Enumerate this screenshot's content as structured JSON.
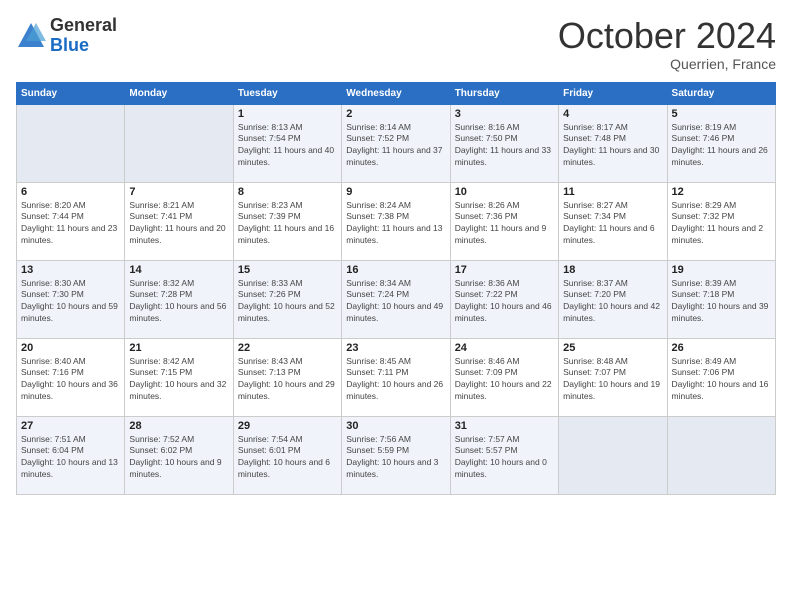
{
  "logo": {
    "general": "General",
    "blue": "Blue"
  },
  "header": {
    "month": "October 2024",
    "location": "Querrien, France"
  },
  "weekdays": [
    "Sunday",
    "Monday",
    "Tuesday",
    "Wednesday",
    "Thursday",
    "Friday",
    "Saturday"
  ],
  "weeks": [
    [
      {
        "day": "",
        "sunrise": "",
        "sunset": "",
        "daylight": ""
      },
      {
        "day": "",
        "sunrise": "",
        "sunset": "",
        "daylight": ""
      },
      {
        "day": "1",
        "sunrise": "Sunrise: 8:13 AM",
        "sunset": "Sunset: 7:54 PM",
        "daylight": "Daylight: 11 hours and 40 minutes."
      },
      {
        "day": "2",
        "sunrise": "Sunrise: 8:14 AM",
        "sunset": "Sunset: 7:52 PM",
        "daylight": "Daylight: 11 hours and 37 minutes."
      },
      {
        "day": "3",
        "sunrise": "Sunrise: 8:16 AM",
        "sunset": "Sunset: 7:50 PM",
        "daylight": "Daylight: 11 hours and 33 minutes."
      },
      {
        "day": "4",
        "sunrise": "Sunrise: 8:17 AM",
        "sunset": "Sunset: 7:48 PM",
        "daylight": "Daylight: 11 hours and 30 minutes."
      },
      {
        "day": "5",
        "sunrise": "Sunrise: 8:19 AM",
        "sunset": "Sunset: 7:46 PM",
        "daylight": "Daylight: 11 hours and 26 minutes."
      }
    ],
    [
      {
        "day": "6",
        "sunrise": "Sunrise: 8:20 AM",
        "sunset": "Sunset: 7:44 PM",
        "daylight": "Daylight: 11 hours and 23 minutes."
      },
      {
        "day": "7",
        "sunrise": "Sunrise: 8:21 AM",
        "sunset": "Sunset: 7:41 PM",
        "daylight": "Daylight: 11 hours and 20 minutes."
      },
      {
        "day": "8",
        "sunrise": "Sunrise: 8:23 AM",
        "sunset": "Sunset: 7:39 PM",
        "daylight": "Daylight: 11 hours and 16 minutes."
      },
      {
        "day": "9",
        "sunrise": "Sunrise: 8:24 AM",
        "sunset": "Sunset: 7:38 PM",
        "daylight": "Daylight: 11 hours and 13 minutes."
      },
      {
        "day": "10",
        "sunrise": "Sunrise: 8:26 AM",
        "sunset": "Sunset: 7:36 PM",
        "daylight": "Daylight: 11 hours and 9 minutes."
      },
      {
        "day": "11",
        "sunrise": "Sunrise: 8:27 AM",
        "sunset": "Sunset: 7:34 PM",
        "daylight": "Daylight: 11 hours and 6 minutes."
      },
      {
        "day": "12",
        "sunrise": "Sunrise: 8:29 AM",
        "sunset": "Sunset: 7:32 PM",
        "daylight": "Daylight: 11 hours and 2 minutes."
      }
    ],
    [
      {
        "day": "13",
        "sunrise": "Sunrise: 8:30 AM",
        "sunset": "Sunset: 7:30 PM",
        "daylight": "Daylight: 10 hours and 59 minutes."
      },
      {
        "day": "14",
        "sunrise": "Sunrise: 8:32 AM",
        "sunset": "Sunset: 7:28 PM",
        "daylight": "Daylight: 10 hours and 56 minutes."
      },
      {
        "day": "15",
        "sunrise": "Sunrise: 8:33 AM",
        "sunset": "Sunset: 7:26 PM",
        "daylight": "Daylight: 10 hours and 52 minutes."
      },
      {
        "day": "16",
        "sunrise": "Sunrise: 8:34 AM",
        "sunset": "Sunset: 7:24 PM",
        "daylight": "Daylight: 10 hours and 49 minutes."
      },
      {
        "day": "17",
        "sunrise": "Sunrise: 8:36 AM",
        "sunset": "Sunset: 7:22 PM",
        "daylight": "Daylight: 10 hours and 46 minutes."
      },
      {
        "day": "18",
        "sunrise": "Sunrise: 8:37 AM",
        "sunset": "Sunset: 7:20 PM",
        "daylight": "Daylight: 10 hours and 42 minutes."
      },
      {
        "day": "19",
        "sunrise": "Sunrise: 8:39 AM",
        "sunset": "Sunset: 7:18 PM",
        "daylight": "Daylight: 10 hours and 39 minutes."
      }
    ],
    [
      {
        "day": "20",
        "sunrise": "Sunrise: 8:40 AM",
        "sunset": "Sunset: 7:16 PM",
        "daylight": "Daylight: 10 hours and 36 minutes."
      },
      {
        "day": "21",
        "sunrise": "Sunrise: 8:42 AM",
        "sunset": "Sunset: 7:15 PM",
        "daylight": "Daylight: 10 hours and 32 minutes."
      },
      {
        "day": "22",
        "sunrise": "Sunrise: 8:43 AM",
        "sunset": "Sunset: 7:13 PM",
        "daylight": "Daylight: 10 hours and 29 minutes."
      },
      {
        "day": "23",
        "sunrise": "Sunrise: 8:45 AM",
        "sunset": "Sunset: 7:11 PM",
        "daylight": "Daylight: 10 hours and 26 minutes."
      },
      {
        "day": "24",
        "sunrise": "Sunrise: 8:46 AM",
        "sunset": "Sunset: 7:09 PM",
        "daylight": "Daylight: 10 hours and 22 minutes."
      },
      {
        "day": "25",
        "sunrise": "Sunrise: 8:48 AM",
        "sunset": "Sunset: 7:07 PM",
        "daylight": "Daylight: 10 hours and 19 minutes."
      },
      {
        "day": "26",
        "sunrise": "Sunrise: 8:49 AM",
        "sunset": "Sunset: 7:06 PM",
        "daylight": "Daylight: 10 hours and 16 minutes."
      }
    ],
    [
      {
        "day": "27",
        "sunrise": "Sunrise: 7:51 AM",
        "sunset": "Sunset: 6:04 PM",
        "daylight": "Daylight: 10 hours and 13 minutes."
      },
      {
        "day": "28",
        "sunrise": "Sunrise: 7:52 AM",
        "sunset": "Sunset: 6:02 PM",
        "daylight": "Daylight: 10 hours and 9 minutes."
      },
      {
        "day": "29",
        "sunrise": "Sunrise: 7:54 AM",
        "sunset": "Sunset: 6:01 PM",
        "daylight": "Daylight: 10 hours and 6 minutes."
      },
      {
        "day": "30",
        "sunrise": "Sunrise: 7:56 AM",
        "sunset": "Sunset: 5:59 PM",
        "daylight": "Daylight: 10 hours and 3 minutes."
      },
      {
        "day": "31",
        "sunrise": "Sunrise: 7:57 AM",
        "sunset": "Sunset: 5:57 PM",
        "daylight": "Daylight: 10 hours and 0 minutes."
      },
      {
        "day": "",
        "sunrise": "",
        "sunset": "",
        "daylight": ""
      },
      {
        "day": "",
        "sunrise": "",
        "sunset": "",
        "daylight": ""
      }
    ]
  ]
}
